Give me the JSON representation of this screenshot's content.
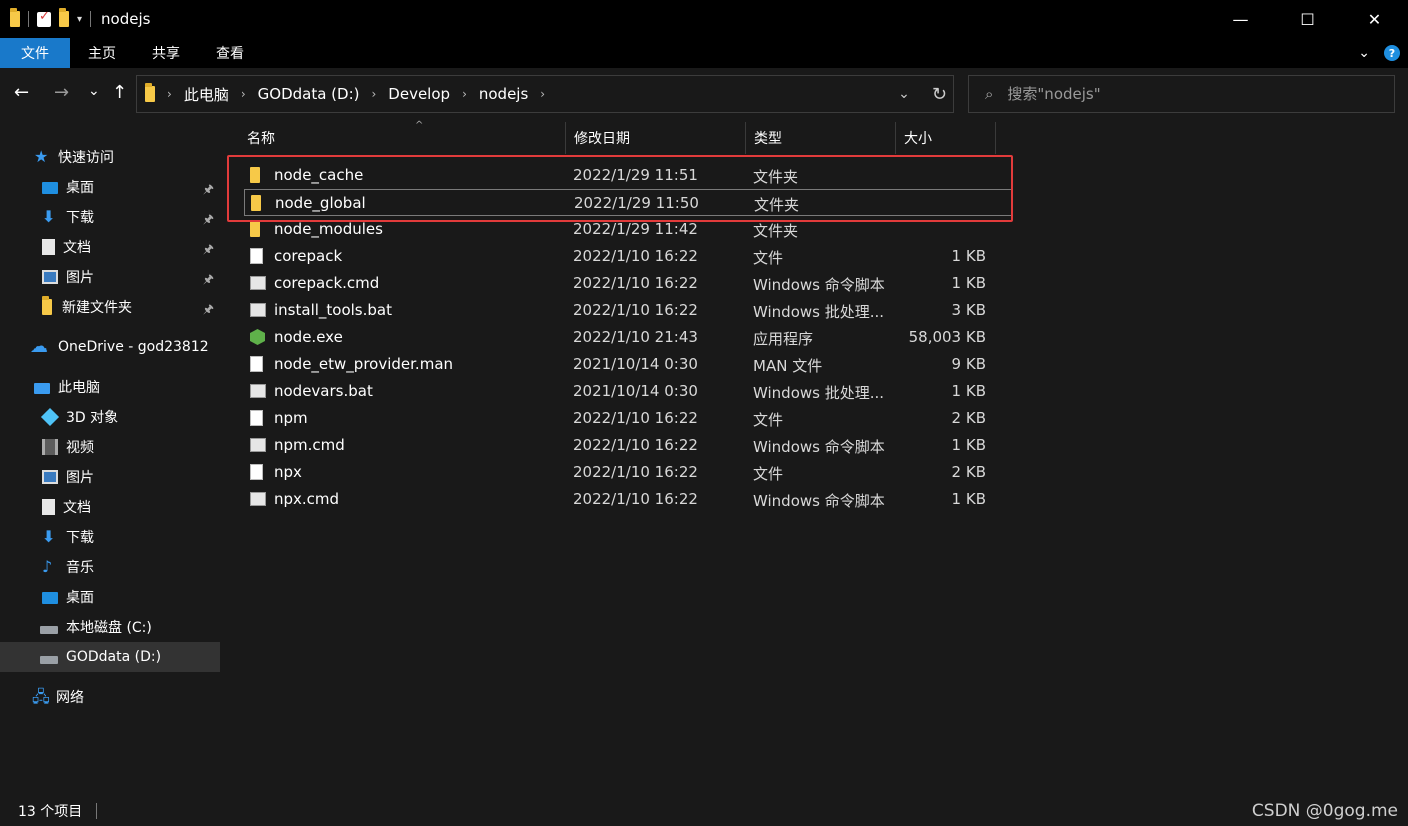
{
  "window": {
    "title": "nodejs",
    "controls": {
      "minimize": "—",
      "maximize": "☐",
      "close": "✕"
    }
  },
  "ribbon": {
    "tabs": [
      {
        "label": "文件",
        "active": true
      },
      {
        "label": "主页"
      },
      {
        "label": "共享"
      },
      {
        "label": "查看"
      }
    ],
    "help": "?"
  },
  "nav": {
    "back": "←",
    "forward": "→",
    "recent": "⌄",
    "up": "↑",
    "breadcrumb": [
      "此电脑",
      "GODdata (D:)",
      "Develop",
      "nodejs"
    ],
    "breadcrumb_sep": "›",
    "dropdown": "⌄",
    "refresh": "↻",
    "search_placeholder": "搜索\"nodejs\""
  },
  "sidebar": {
    "quick_access": "快速访问",
    "quick_items": [
      {
        "label": "桌面",
        "icon": "desktop-icon",
        "pinned": true
      },
      {
        "label": "下载",
        "icon": "download-icon",
        "pinned": true
      },
      {
        "label": "文档",
        "icon": "document-icon",
        "pinned": true
      },
      {
        "label": "图片",
        "icon": "pictures-icon",
        "pinned": true
      },
      {
        "label": "新建文件夹",
        "icon": "folder-icon",
        "pinned": true
      }
    ],
    "onedrive": "OneDrive - god23812",
    "this_pc": "此电脑",
    "pc_items": [
      {
        "label": "3D 对象",
        "icon": "3d-objects-icon"
      },
      {
        "label": "视频",
        "icon": "video-icon"
      },
      {
        "label": "图片",
        "icon": "pictures-icon"
      },
      {
        "label": "文档",
        "icon": "document-icon"
      },
      {
        "label": "下载",
        "icon": "download-icon"
      },
      {
        "label": "音乐",
        "icon": "music-icon"
      },
      {
        "label": "桌面",
        "icon": "desktop-icon"
      },
      {
        "label": "本地磁盘 (C:)",
        "icon": "drive-icon"
      },
      {
        "label": "GODdata (D:)",
        "icon": "drive-icon",
        "selected": true
      }
    ],
    "network": "网络",
    "pin_glyph": "📌"
  },
  "columns": {
    "name": "名称",
    "date": "修改日期",
    "type": "类型",
    "size": "大小"
  },
  "files": [
    {
      "name": "node_cache",
      "date": "2022/1/29 11:51",
      "type": "文件夹",
      "size": "",
      "icon": "folder"
    },
    {
      "name": "node_global",
      "date": "2022/1/29 11:50",
      "type": "文件夹",
      "size": "",
      "icon": "folder",
      "focused": true
    },
    {
      "name": "node_modules",
      "date": "2022/1/29 11:42",
      "type": "文件夹",
      "size": "",
      "icon": "folder"
    },
    {
      "name": "corepack",
      "date": "2022/1/10 16:22",
      "type": "文件",
      "size": "1 KB",
      "icon": "file"
    },
    {
      "name": "corepack.cmd",
      "date": "2022/1/10 16:22",
      "type": "Windows 命令脚本",
      "size": "1 KB",
      "icon": "cmd"
    },
    {
      "name": "install_tools.bat",
      "date": "2022/1/10 16:22",
      "type": "Windows 批处理...",
      "size": "3 KB",
      "icon": "cmd"
    },
    {
      "name": "node.exe",
      "date": "2022/1/10 21:43",
      "type": "应用程序",
      "size": "58,003 KB",
      "icon": "exe"
    },
    {
      "name": "node_etw_provider.man",
      "date": "2021/10/14 0:30",
      "type": "MAN 文件",
      "size": "9 KB",
      "icon": "file"
    },
    {
      "name": "nodevars.bat",
      "date": "2021/10/14 0:30",
      "type": "Windows 批处理...",
      "size": "1 KB",
      "icon": "cmd"
    },
    {
      "name": "npm",
      "date": "2022/1/10 16:22",
      "type": "文件",
      "size": "2 KB",
      "icon": "file"
    },
    {
      "name": "npm.cmd",
      "date": "2022/1/10 16:22",
      "type": "Windows 命令脚本",
      "size": "1 KB",
      "icon": "cmd"
    },
    {
      "name": "npx",
      "date": "2022/1/10 16:22",
      "type": "文件",
      "size": "2 KB",
      "icon": "file"
    },
    {
      "name": "npx.cmd",
      "date": "2022/1/10 16:22",
      "type": "Windows 命令脚本",
      "size": "1 KB",
      "icon": "cmd"
    }
  ],
  "status": {
    "count": "13 个项目"
  },
  "watermark": "CSDN @0gog.me",
  "colors": {
    "accent": "#1979ca",
    "highlight": "#e23b3b",
    "background": "#191919"
  }
}
